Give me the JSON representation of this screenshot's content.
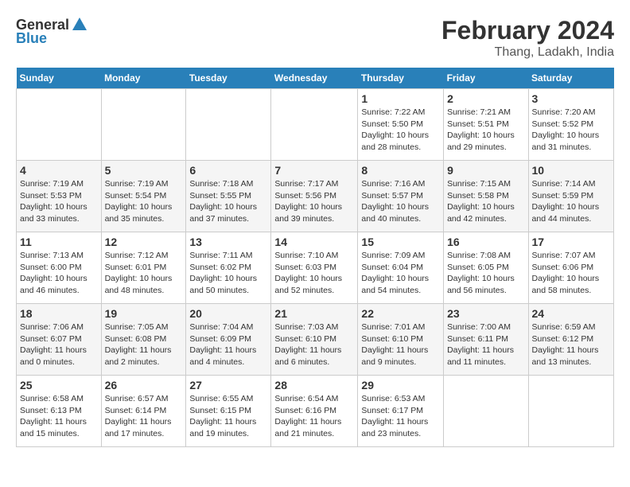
{
  "header": {
    "logo_general": "General",
    "logo_blue": "Blue",
    "month_year": "February 2024",
    "location": "Thang, Ladakh, India"
  },
  "calendar": {
    "weekdays": [
      "Sunday",
      "Monday",
      "Tuesday",
      "Wednesday",
      "Thursday",
      "Friday",
      "Saturday"
    ],
    "weeks": [
      [
        {
          "day": "",
          "sunrise": "",
          "sunset": "",
          "daylight": ""
        },
        {
          "day": "",
          "sunrise": "",
          "sunset": "",
          "daylight": ""
        },
        {
          "day": "",
          "sunrise": "",
          "sunset": "",
          "daylight": ""
        },
        {
          "day": "",
          "sunrise": "",
          "sunset": "",
          "daylight": ""
        },
        {
          "day": "1",
          "sunrise": "Sunrise: 7:22 AM",
          "sunset": "Sunset: 5:50 PM",
          "daylight": "Daylight: 10 hours and 28 minutes."
        },
        {
          "day": "2",
          "sunrise": "Sunrise: 7:21 AM",
          "sunset": "Sunset: 5:51 PM",
          "daylight": "Daylight: 10 hours and 29 minutes."
        },
        {
          "day": "3",
          "sunrise": "Sunrise: 7:20 AM",
          "sunset": "Sunset: 5:52 PM",
          "daylight": "Daylight: 10 hours and 31 minutes."
        }
      ],
      [
        {
          "day": "4",
          "sunrise": "Sunrise: 7:19 AM",
          "sunset": "Sunset: 5:53 PM",
          "daylight": "Daylight: 10 hours and 33 minutes."
        },
        {
          "day": "5",
          "sunrise": "Sunrise: 7:19 AM",
          "sunset": "Sunset: 5:54 PM",
          "daylight": "Daylight: 10 hours and 35 minutes."
        },
        {
          "day": "6",
          "sunrise": "Sunrise: 7:18 AM",
          "sunset": "Sunset: 5:55 PM",
          "daylight": "Daylight: 10 hours and 37 minutes."
        },
        {
          "day": "7",
          "sunrise": "Sunrise: 7:17 AM",
          "sunset": "Sunset: 5:56 PM",
          "daylight": "Daylight: 10 hours and 39 minutes."
        },
        {
          "day": "8",
          "sunrise": "Sunrise: 7:16 AM",
          "sunset": "Sunset: 5:57 PM",
          "daylight": "Daylight: 10 hours and 40 minutes."
        },
        {
          "day": "9",
          "sunrise": "Sunrise: 7:15 AM",
          "sunset": "Sunset: 5:58 PM",
          "daylight": "Daylight: 10 hours and 42 minutes."
        },
        {
          "day": "10",
          "sunrise": "Sunrise: 7:14 AM",
          "sunset": "Sunset: 5:59 PM",
          "daylight": "Daylight: 10 hours and 44 minutes."
        }
      ],
      [
        {
          "day": "11",
          "sunrise": "Sunrise: 7:13 AM",
          "sunset": "Sunset: 6:00 PM",
          "daylight": "Daylight: 10 hours and 46 minutes."
        },
        {
          "day": "12",
          "sunrise": "Sunrise: 7:12 AM",
          "sunset": "Sunset: 6:01 PM",
          "daylight": "Daylight: 10 hours and 48 minutes."
        },
        {
          "day": "13",
          "sunrise": "Sunrise: 7:11 AM",
          "sunset": "Sunset: 6:02 PM",
          "daylight": "Daylight: 10 hours and 50 minutes."
        },
        {
          "day": "14",
          "sunrise": "Sunrise: 7:10 AM",
          "sunset": "Sunset: 6:03 PM",
          "daylight": "Daylight: 10 hours and 52 minutes."
        },
        {
          "day": "15",
          "sunrise": "Sunrise: 7:09 AM",
          "sunset": "Sunset: 6:04 PM",
          "daylight": "Daylight: 10 hours and 54 minutes."
        },
        {
          "day": "16",
          "sunrise": "Sunrise: 7:08 AM",
          "sunset": "Sunset: 6:05 PM",
          "daylight": "Daylight: 10 hours and 56 minutes."
        },
        {
          "day": "17",
          "sunrise": "Sunrise: 7:07 AM",
          "sunset": "Sunset: 6:06 PM",
          "daylight": "Daylight: 10 hours and 58 minutes."
        }
      ],
      [
        {
          "day": "18",
          "sunrise": "Sunrise: 7:06 AM",
          "sunset": "Sunset: 6:07 PM",
          "daylight": "Daylight: 11 hours and 0 minutes."
        },
        {
          "day": "19",
          "sunrise": "Sunrise: 7:05 AM",
          "sunset": "Sunset: 6:08 PM",
          "daylight": "Daylight: 11 hours and 2 minutes."
        },
        {
          "day": "20",
          "sunrise": "Sunrise: 7:04 AM",
          "sunset": "Sunset: 6:09 PM",
          "daylight": "Daylight: 11 hours and 4 minutes."
        },
        {
          "day": "21",
          "sunrise": "Sunrise: 7:03 AM",
          "sunset": "Sunset: 6:10 PM",
          "daylight": "Daylight: 11 hours and 6 minutes."
        },
        {
          "day": "22",
          "sunrise": "Sunrise: 7:01 AM",
          "sunset": "Sunset: 6:10 PM",
          "daylight": "Daylight: 11 hours and 9 minutes."
        },
        {
          "day": "23",
          "sunrise": "Sunrise: 7:00 AM",
          "sunset": "Sunset: 6:11 PM",
          "daylight": "Daylight: 11 hours and 11 minutes."
        },
        {
          "day": "24",
          "sunrise": "Sunrise: 6:59 AM",
          "sunset": "Sunset: 6:12 PM",
          "daylight": "Daylight: 11 hours and 13 minutes."
        }
      ],
      [
        {
          "day": "25",
          "sunrise": "Sunrise: 6:58 AM",
          "sunset": "Sunset: 6:13 PM",
          "daylight": "Daylight: 11 hours and 15 minutes."
        },
        {
          "day": "26",
          "sunrise": "Sunrise: 6:57 AM",
          "sunset": "Sunset: 6:14 PM",
          "daylight": "Daylight: 11 hours and 17 minutes."
        },
        {
          "day": "27",
          "sunrise": "Sunrise: 6:55 AM",
          "sunset": "Sunset: 6:15 PM",
          "daylight": "Daylight: 11 hours and 19 minutes."
        },
        {
          "day": "28",
          "sunrise": "Sunrise: 6:54 AM",
          "sunset": "Sunset: 6:16 PM",
          "daylight": "Daylight: 11 hours and 21 minutes."
        },
        {
          "day": "29",
          "sunrise": "Sunrise: 6:53 AM",
          "sunset": "Sunset: 6:17 PM",
          "daylight": "Daylight: 11 hours and 23 minutes."
        },
        {
          "day": "",
          "sunrise": "",
          "sunset": "",
          "daylight": ""
        },
        {
          "day": "",
          "sunrise": "",
          "sunset": "",
          "daylight": ""
        }
      ]
    ]
  }
}
